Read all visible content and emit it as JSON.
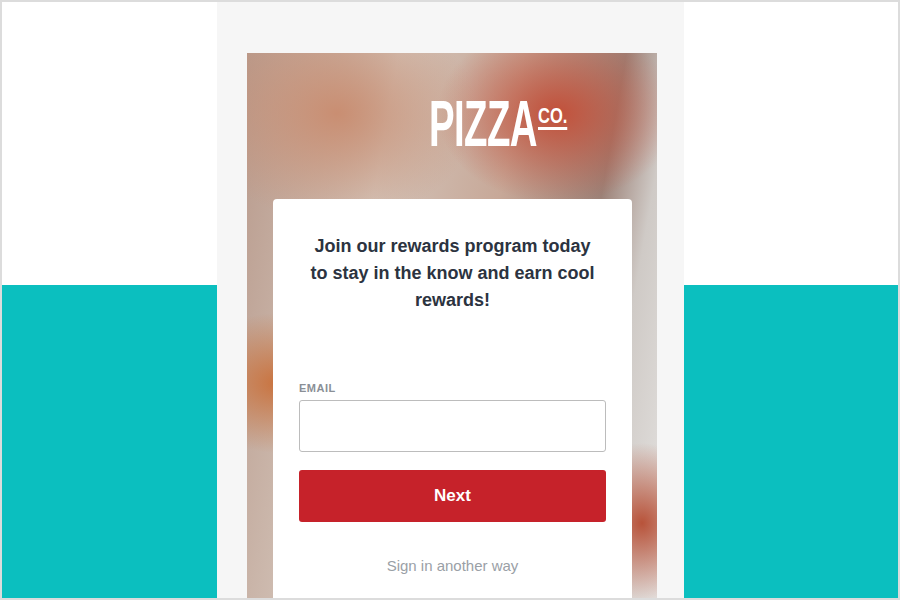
{
  "logo": {
    "main": "PIZZA",
    "suffix": "CO."
  },
  "card": {
    "heading": "Join our rewards program today to stay in the know and earn cool rewards!",
    "email": {
      "label": "EMAIL",
      "value": ""
    },
    "next_button": "Next",
    "alt_link": "Sign in another way"
  }
}
